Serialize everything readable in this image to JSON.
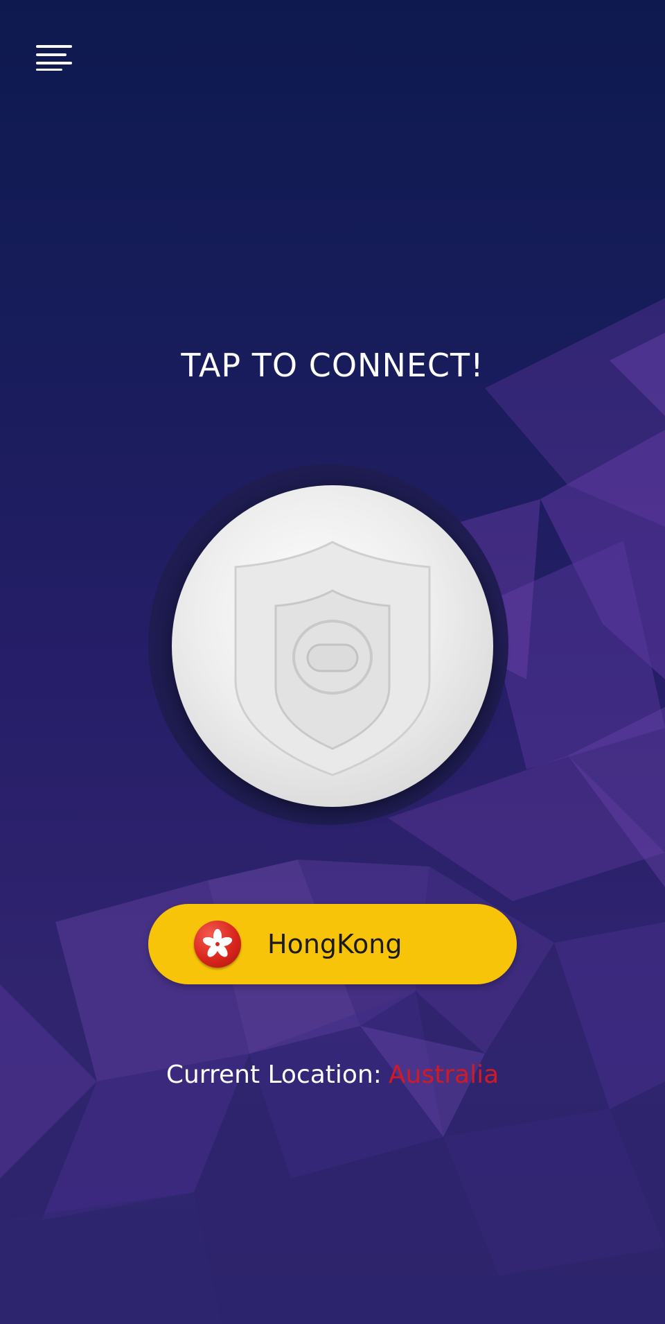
{
  "app": {
    "menu_icon": "hamburger-menu-icon",
    "title": "TAP TO CONNECT!"
  },
  "connect_button": {
    "icon": "shield-icon",
    "colors": {
      "face": "#eeeeee",
      "halo": "#1e1c50"
    }
  },
  "server": {
    "flag_icon": "hong-kong-flag-icon",
    "name": "HongKong",
    "pill_color": "#f8c40a"
  },
  "location": {
    "label": "Current Location:",
    "value": "Australia",
    "value_color": "#d01a27"
  }
}
